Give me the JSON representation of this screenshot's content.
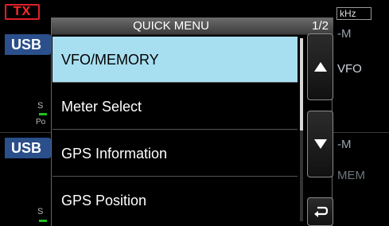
{
  "background": {
    "tx_label": "TX",
    "mode_top": "USB",
    "mode_bottom": "USB",
    "s_label_1": "S",
    "po_label": "Po",
    "s_label_2": "S",
    "khz_label": "kHz",
    "right_m_1": "-M",
    "right_vfo": "VFO",
    "right_m_2": "-M",
    "right_mem": "MEM"
  },
  "menu": {
    "title": "QUICK MENU",
    "page": "1/2",
    "items": [
      {
        "label": "VFO/MEMORY",
        "selected": true
      },
      {
        "label": "Meter Select",
        "selected": false
      },
      {
        "label": "GPS Information",
        "selected": false
      },
      {
        "label": "GPS Position",
        "selected": false
      }
    ]
  },
  "controls": {
    "up_icon": "triangle-up-icon",
    "down_icon": "triangle-down-icon",
    "back_icon": "return-arrow-icon"
  },
  "colors": {
    "selected_item": "#a8dff0",
    "tx_red": "#e0202a",
    "mode_blue": "#2a4f8a"
  }
}
